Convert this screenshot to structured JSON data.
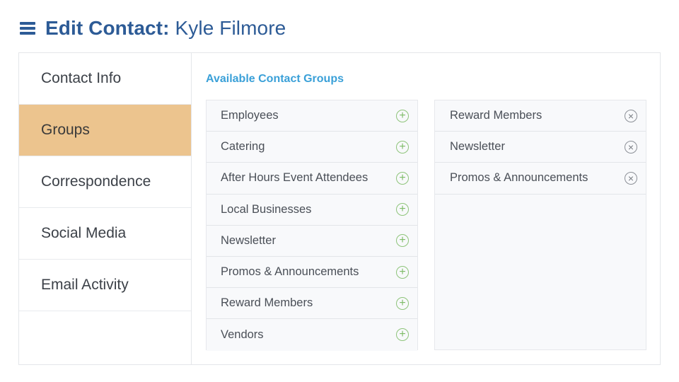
{
  "header": {
    "menu_icon": "hamburger-menu-icon",
    "title_prefix": "Edit Contact:",
    "contact_name": "Kyle Filmore"
  },
  "sidebar": {
    "items": [
      {
        "label": "Contact Info",
        "active": false
      },
      {
        "label": "Groups",
        "active": true
      },
      {
        "label": "Correspondence",
        "active": false
      },
      {
        "label": "Social Media",
        "active": false
      },
      {
        "label": "Email Activity",
        "active": false
      }
    ]
  },
  "main": {
    "section_title": "Available Contact Groups",
    "available_groups": [
      "Employees",
      "Catering",
      "After Hours Event Attendees",
      "Local Businesses",
      "Newsletter",
      "Promos & Announcements",
      "Reward Members",
      "Vendors"
    ],
    "selected_groups": [
      "Reward Members",
      "Newsletter",
      "Promos & Announcements"
    ],
    "add_icon": "plus-circle-icon",
    "remove_icon": "x-circle-icon"
  },
  "colors": {
    "title_blue": "#2d5b96",
    "section_title_blue": "#3aa0d8",
    "active_tab": "#ecc48e",
    "add_green": "#7dbb66"
  }
}
